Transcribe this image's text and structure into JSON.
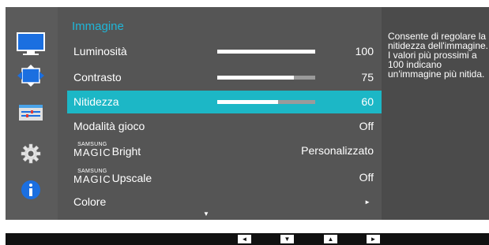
{
  "menu": {
    "title": "Immagine",
    "items": [
      {
        "label": "Luminosità",
        "value": "100",
        "bar_level": 1.0
      },
      {
        "label": "Contrasto",
        "value": "75",
        "bar_level": 0.78
      },
      {
        "label": "Nitidezza",
        "value": "60",
        "bar_level": 0.62,
        "selected": true
      },
      {
        "label": "Modalità gioco",
        "value": "Off"
      },
      {
        "brand_small": "SAMSUNG",
        "brand_big": "MAGIC",
        "label": "Bright",
        "value": "Personalizzato"
      },
      {
        "brand_small": "SAMSUNG",
        "brand_big": "MAGIC",
        "label": "Upscale",
        "value": "Off"
      },
      {
        "label": "Colore",
        "value": "►"
      }
    ],
    "scroll_indicator": "▼"
  },
  "help": {
    "text": "Consente di regolare la nitidezza dell'immagine. I valori più prossimi a 100 indicano un'immagine più nitida."
  },
  "sidebar": {
    "icons": [
      "monitor-icon",
      "screen-size-icon",
      "color-settings-icon",
      "gear-icon",
      "info-icon"
    ]
  },
  "nav_buttons": {
    "left": "◄",
    "down": "▼",
    "up": "▲",
    "right": "►"
  },
  "colors": {
    "accent": "#1cb7c6",
    "title": "#1fb6d8",
    "panel_bg": "#555555",
    "sidebar_bg": "#5b5b5b",
    "help_bg": "#4b4b4b"
  }
}
